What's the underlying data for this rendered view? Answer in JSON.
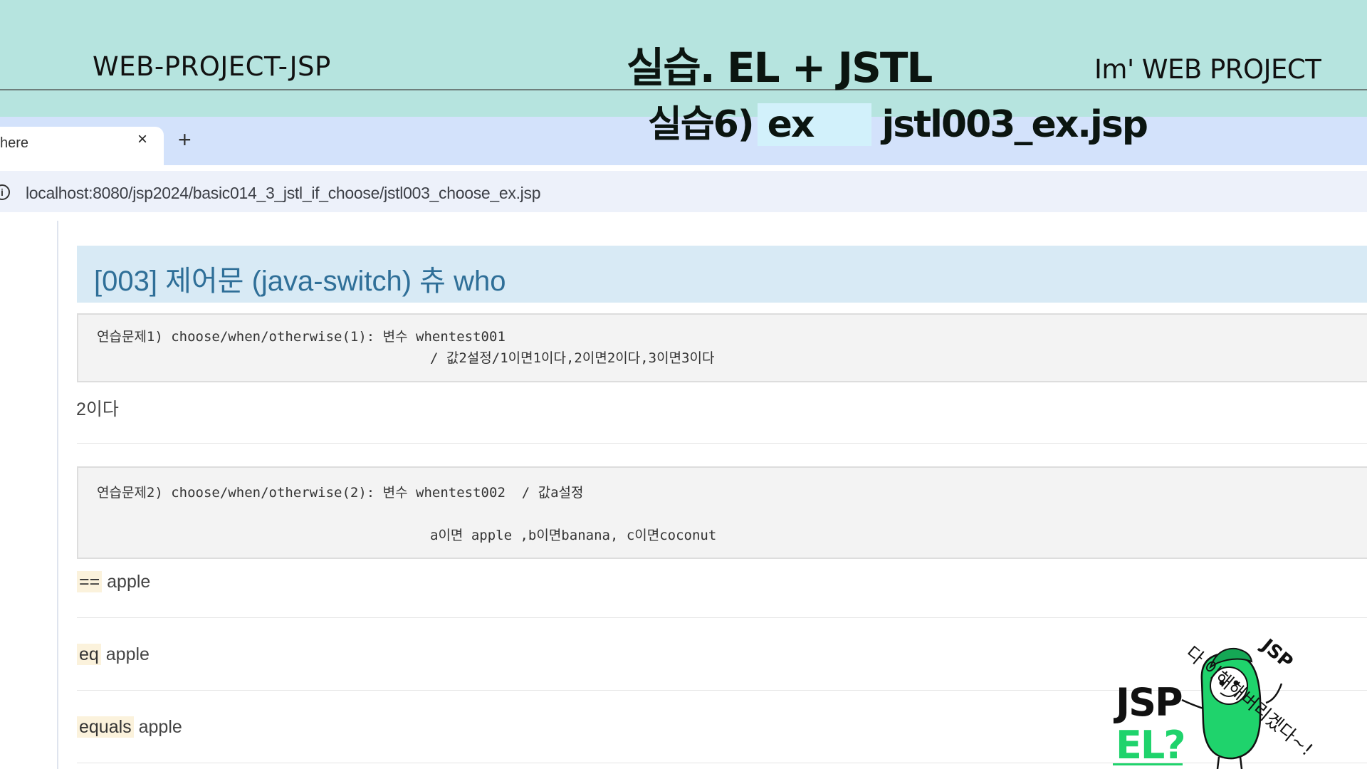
{
  "slide": {
    "project_label": "WEB-PROJECT-JSP",
    "title": "실습. EL + JSTL",
    "brand": "Im'  WEB PROJECT",
    "subtitle_prefix": "실습6)",
    "subtitle_highlight": "ex",
    "subtitle_file": "jstl003_ex.jsp"
  },
  "browser": {
    "tab_title": "here",
    "tab_close": "×",
    "new_tab": "+",
    "url": "localhost:8080/jsp2024/basic014_3_jstl_if_choose/jstl003_choose_ex.jsp"
  },
  "page": {
    "heading": "[003] 제어문 (java-switch) 츄 who",
    "exercise1": {
      "line1": "연습문제1) choose/when/otherwise(1): 변수 whentest001",
      "line2": "/ 값2설정/1이면1이다,2이면2이다,3이면3이다"
    },
    "result1": "2이다",
    "exercise2": {
      "line1": "연습문제2) choose/when/otherwise(2): 변수 whentest002  / 값a설정",
      "line2": "a이면 apple ,b이면banana, c이면coconut"
    },
    "results2": [
      {
        "code": "==",
        "text": "apple"
      },
      {
        "code": "eq",
        "text": "apple"
      },
      {
        "code": "equals",
        "text": "apple"
      }
    ]
  },
  "mascot": {
    "jsp": "JSP",
    "el": "EL?",
    "speech": "다 이해해버리겠다~!",
    "speech_jsp": "JSP"
  },
  "colors": {
    "banner": "#b6e4df",
    "heading_text": "#2f6f98",
    "mascot_green": "#1fd36c"
  }
}
